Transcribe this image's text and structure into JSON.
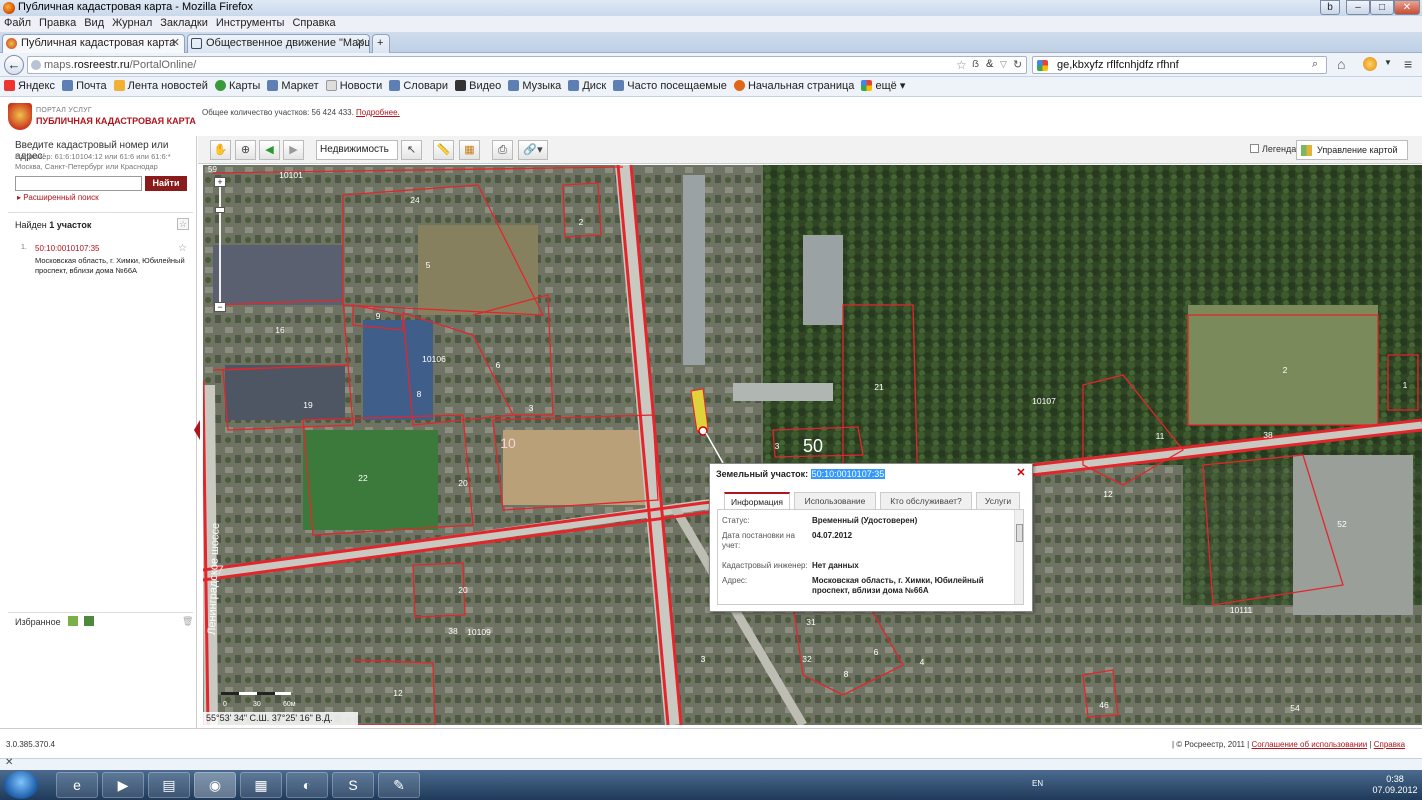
{
  "window": {
    "title": "Публичная кадастровая карта - Mozilla Firefox"
  },
  "menu": [
    "Файл",
    "Правка",
    "Вид",
    "Журнал",
    "Закладки",
    "Инструменты",
    "Справка"
  ],
  "tabs": [
    {
      "label": "Публичная кадастровая карта",
      "active": true
    },
    {
      "label": "Общественное движение \"Марш п...",
      "active": false
    }
  ],
  "nav": {
    "url_prefix": "maps.",
    "url_domain": "rosreestr.ru",
    "url_path": "/PortalOnline/",
    "search_value": "ge,kbxyfz rflfcnhjdfz rfhnf"
  },
  "bookmarks": [
    "Яндекс",
    "Почта",
    "Лента новостей",
    "Карты",
    "Маркет",
    "Новости",
    "Словари",
    "Видео",
    "Музыка",
    "Диск",
    "Часто посещаемые",
    "Начальная страница",
    "ещё"
  ],
  "header": {
    "portal_small": "ПОРТАЛ УСЛУГ",
    "portal_name": "ПУБЛИЧНАЯ КАДАСТРОВАЯ КАРТА",
    "parcels_text": "Общее количество участков: 56 424 433.",
    "parcels_link": "Подробнее."
  },
  "left": {
    "search_title": "Введите кадастровый номер или адрес:",
    "search_hint": "Например: 61:6:10104:12 или 61:6 или 61:6:* Москва, Санкт-Петербург или Краснодар",
    "find_button": "Найти",
    "advanced": "Расширенный поиск",
    "found_prefix": "Найден",
    "found_count": "1 участок",
    "result": {
      "num": "1.",
      "code": "50:10:0010107:35",
      "address": "Московская область, г. Химки, Юбилейный проспект, вблизи дома №66А"
    },
    "favorites": "Избранное"
  },
  "toolbar": {
    "realty_select": "Недвижимость",
    "legend": "Легенда",
    "map_management": "Управление картой"
  },
  "map": {
    "coords": "55°53' 34\" С.Ш.   37°25' 16\" В.Д.",
    "scale_labels": [
      "0",
      "30",
      "60м"
    ],
    "zoom_top": "59",
    "street": "Ленинградское шоссе",
    "labels": [
      "10101",
      "24",
      "5",
      "16",
      "9",
      "10106",
      "6",
      "19",
      "8",
      "3",
      "10",
      "22",
      "20",
      "21",
      "10107",
      "11",
      "2",
      "38",
      "50",
      "12",
      "52",
      "10111",
      "20",
      "38",
      "10109",
      "12",
      "31",
      "32",
      "6",
      "8",
      "4",
      "46",
      "54",
      "3",
      "7",
      "2",
      "1",
      "3"
    ]
  },
  "popup": {
    "title": "Земельный участок:",
    "code": "50:10:0010107:35",
    "tabs": [
      "Информация",
      "Использование",
      "Кто обслуживает?",
      "Услуги"
    ],
    "rows": [
      {
        "key": "Статус:",
        "value": "Временный (Удостоверен)"
      },
      {
        "key": "Дата постановки на учет:",
        "value": "04.07.2012"
      },
      {
        "key": "Кадастровый инженер:",
        "value": "Нет данных"
      },
      {
        "key": "Адрес:",
        "value": "Московская область, г. Химки, Юбилейный проспект, вблизи дома №66А"
      }
    ]
  },
  "footer": {
    "version": "3.0.385.370.4",
    "copyright": "| © Росреестр, 2011 |",
    "terms": "Соглашение об использовании",
    "help": "Справка"
  },
  "taskbar": {
    "lang": "EN",
    "time": "0:38",
    "date": "07.09.2012"
  }
}
